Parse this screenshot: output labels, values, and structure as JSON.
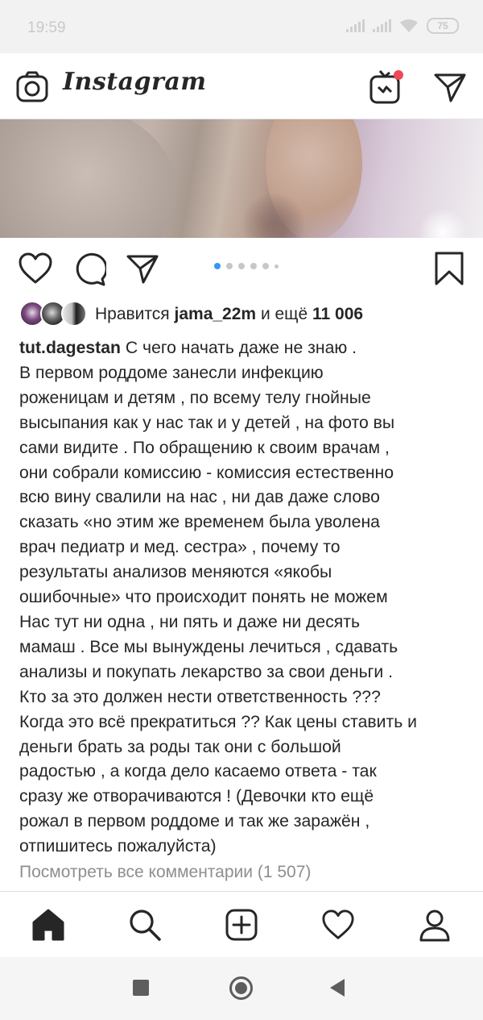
{
  "status_bar": {
    "time": "19:59",
    "battery": "75",
    "icons": [
      "signal-icon",
      "signal-icon",
      "wifi-icon",
      "battery-icon"
    ]
  },
  "header": {
    "logo": "Instagram",
    "icons": [
      "camera-icon",
      "igtv-icon",
      "direct-icon"
    ],
    "notification_dot_color": "#ed4956"
  },
  "post": {
    "carousel": {
      "total": 6,
      "active_index": 0,
      "active_color": "#3897f0"
    },
    "actions": [
      "heart-icon",
      "comment-icon",
      "share-icon",
      "bookmark-icon"
    ],
    "likes": {
      "prefix": "Нравится",
      "user": "jama_22m",
      "middle": "и ещё",
      "count": "11 006"
    },
    "caption": {
      "username": "tut.dagestan",
      "text": " С чего начать даже не знаю .\nВ первом роддоме занесли инфекцию\nроженицам и детям , по всему телу гнойные\nвысыпания как у нас так и у детей , на фото вы\nсами видите . По обращению к своим врачам ,\nони собрали комиссию - комиссия естественно\nвсю вину свалили на нас , ни дав даже слово\nсказать «но этим же временем была уволена\nврач педиатр и мед. сестра» , почему то\nрезультаты анализов меняются «якобы\nошибочные» что происходит понять не можем\nНас тут ни одна , ни пять и даже ни десять\nмамаш . Все мы вынуждены лечиться , сдавать\nанализы и покупать лекарство за свои деньги .\nКто за это должен нести ответственность ???\nКогда это всё прекратиться ?? Как цены ставить и\nденьги брать за роды так они с большой\nрадостью , а когда дело касаемо ответа - так\nсразу же отворачиваются ! (Девочки кто ещё\nрожал в первом роддоме и так же заражён ,\nотпишитесь пожалуйста)"
    },
    "view_comments": "Посмотреть все комментарии (1 507)"
  },
  "bottom_nav": [
    "home-icon",
    "search-icon",
    "add-post-icon",
    "activity-icon",
    "profile-icon"
  ],
  "android_nav": [
    "recents-button",
    "home-button",
    "back-button"
  ]
}
